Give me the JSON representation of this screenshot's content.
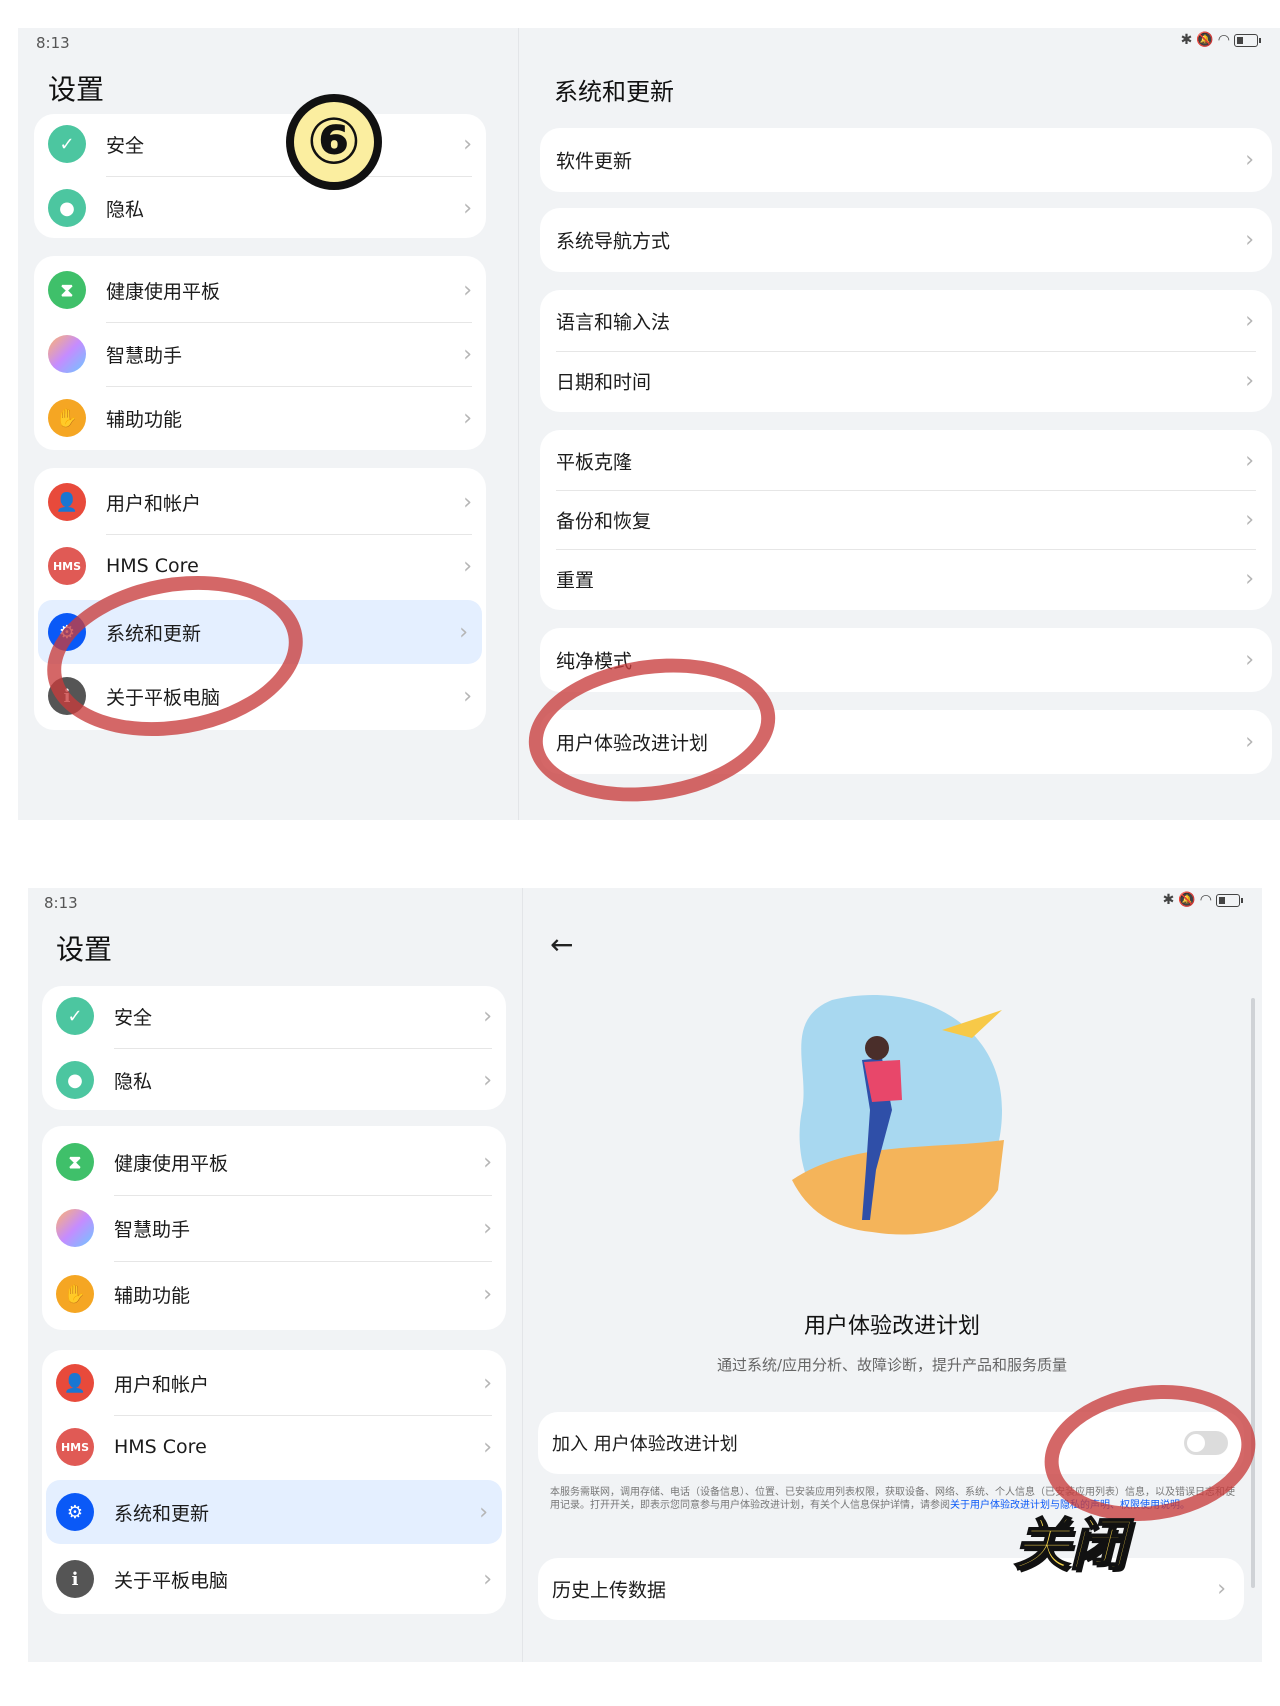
{
  "status_bar": {
    "time": "8:13"
  },
  "settings_sidebar": {
    "title": "设置",
    "group1": [
      {
        "label": "安全",
        "icon": "shield-check-icon"
      },
      {
        "label": "隐私",
        "icon": "privacy-icon"
      }
    ],
    "group2": [
      {
        "label": "健康使用平板",
        "icon": "hourglass-icon"
      },
      {
        "label": "智慧助手",
        "icon": "assistant-icon"
      },
      {
        "label": "辅助功能",
        "icon": "hand-icon"
      }
    ],
    "group3": [
      {
        "label": "用户和帐户",
        "icon": "user-icon"
      },
      {
        "label": "HMS Core",
        "icon_text": "HMS"
      },
      {
        "label": "系统和更新",
        "icon": "gear-icon"
      },
      {
        "label": "关于平板电脑",
        "icon_text": "i"
      }
    ]
  },
  "system_update": {
    "title": "系统和更新",
    "groups": [
      [
        "软件更新"
      ],
      [
        "系统导航方式"
      ],
      [
        "语言和输入法",
        "日期和时间"
      ],
      [
        "平板克隆",
        "备份和恢复",
        "重置"
      ],
      [
        "纯净模式"
      ],
      [
        "用户体验改进计划"
      ]
    ]
  },
  "step_badge": "⑥",
  "ux_plan": {
    "title": "用户体验改进计划",
    "subtitle": "通过系统/应用分析、故障诊断，提升产品和服务质量",
    "join_label": "加入 用户体验改进计划",
    "join_enabled": false,
    "disclaimer": "本服务需联网，调用存储、电话（设备信息）、位置、已安装应用列表权限，获取设备、网络、系统、个人信息（已安装应用列表）信息，以及错误日志和使用记录。打开开关，即表示您同意参与用户体验改进计划，有关个人信息保护详情，请参阅",
    "disclaimer_link": "关于用户体验改进计划与隐私的声明、权限使用说明。",
    "history_label": "历史上传数据",
    "annotation": "关闭"
  },
  "colors": {
    "accent": "#0a59f7",
    "selected_bg": "#e4efff",
    "annotation_red": "#c83c3c"
  }
}
